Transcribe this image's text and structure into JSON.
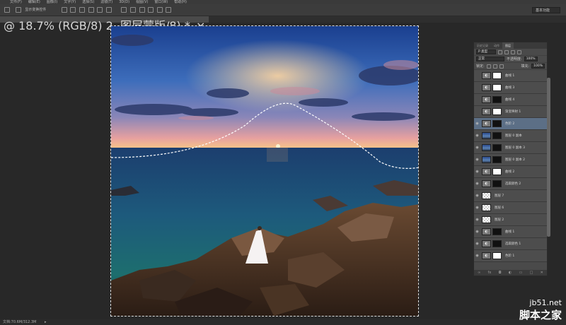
{
  "menubar": {
    "items": [
      "文件(F)",
      "编辑(E)",
      "图像(I)",
      "文字(Y)",
      "选择(S)",
      "滤镜(T)",
      "3D(D)",
      "视图(V)",
      "窗口(W)",
      "帮助(H)"
    ]
  },
  "options": {
    "show_transform": "显示变换控件",
    "workspace": "基本功能"
  },
  "tab": {
    "label": "@ 18.7% (RGB/8) 2, 图层蒙版/8) *",
    "close": "×"
  },
  "status": {
    "text": "文档:70.6M/312.3M"
  },
  "panel": {
    "tabs": [
      "历史记录",
      "动作",
      "图层"
    ],
    "kind": "P 类型",
    "blend": "正常",
    "opacity_label": "不透明度:",
    "opacity_value": "100%",
    "lock_label": "锁定:",
    "fill_label": "填充:",
    "fill_value": "100%",
    "layers": [
      {
        "name": "曲线 1",
        "type": "adj",
        "mask": "mask",
        "visible": false
      },
      {
        "name": "曲线 3",
        "type": "adj",
        "mask": "mask",
        "visible": false
      },
      {
        "name": "曲线 4",
        "type": "adj",
        "mask": "dark",
        "visible": false
      },
      {
        "name": "渐变映射 1",
        "type": "adj",
        "mask": "mask",
        "visible": false
      },
      {
        "name": "色阶 2",
        "type": "adj",
        "mask": "dark",
        "visible": true,
        "selected": true
      },
      {
        "name": "图层 0 副本",
        "type": "photo",
        "mask": "dark",
        "visible": true
      },
      {
        "name": "图层 0 副本 3",
        "type": "photo",
        "mask": "dark",
        "visible": true
      },
      {
        "name": "图层 0 副本 2",
        "type": "photo",
        "mask": "dark",
        "visible": true
      },
      {
        "name": "曲线 2",
        "type": "adj",
        "mask": "mask",
        "visible": true
      },
      {
        "name": "选取颜色 2",
        "type": "adj",
        "mask": "dark",
        "visible": true
      },
      {
        "name": "图层 7",
        "type": "check",
        "mask": "",
        "visible": true
      },
      {
        "name": "图层 6",
        "type": "check",
        "mask": "",
        "visible": true
      },
      {
        "name": "图层 2",
        "type": "check",
        "mask": "",
        "visible": true
      },
      {
        "name": "曲线 1",
        "type": "adj",
        "mask": "dark",
        "visible": true
      },
      {
        "name": "选取颜色 1",
        "type": "adj",
        "mask": "dark",
        "visible": true
      },
      {
        "name": "色阶 1",
        "type": "adj",
        "mask": "mask",
        "visible": true
      }
    ]
  },
  "watermark": {
    "site": "jb51.net",
    "name": "脚本之家"
  }
}
